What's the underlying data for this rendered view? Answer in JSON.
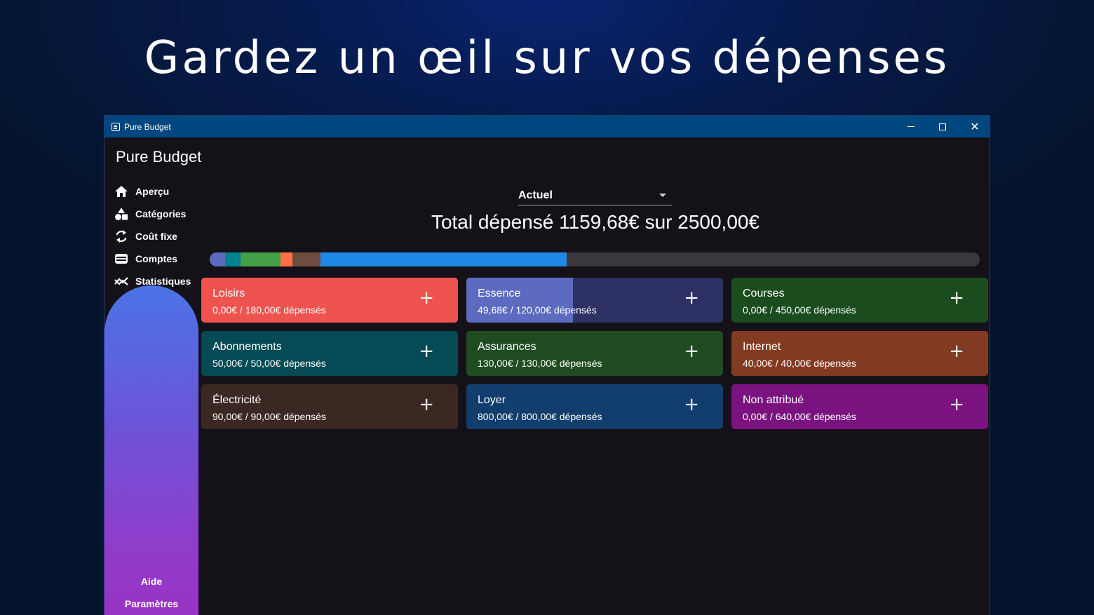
{
  "headline": "Gardez un œil sur vos dépenses",
  "window": {
    "title": "Pure Budget",
    "app_title": "Pure Budget"
  },
  "sidebar": {
    "items": [
      {
        "label": "Aperçu",
        "icon": "home-icon"
      },
      {
        "label": "Catégories",
        "icon": "shapes-icon"
      },
      {
        "label": "Coût fixe",
        "icon": "refresh-icon"
      },
      {
        "label": "Comptes",
        "icon": "wallet-icon"
      },
      {
        "label": "Statistiques",
        "icon": "chart-icon"
      }
    ],
    "help": "Aide",
    "settings": "Paramètres"
  },
  "period": {
    "selected": "Actuel"
  },
  "total": "Total dépensé 1159,68€ sur 2500,00€",
  "progress": {
    "total_spent": 1159.68,
    "budget": 2500.0,
    "segments": [
      {
        "name": "Essence",
        "value": 49.68,
        "color": "#5c6bc0"
      },
      {
        "name": "Abonnements",
        "value": 50.0,
        "color": "#00838f"
      },
      {
        "name": "Assurances",
        "value": 130.0,
        "color": "#43a047"
      },
      {
        "name": "Internet",
        "value": 40.0,
        "color": "#ff7043"
      },
      {
        "name": "Électricité",
        "value": 90.0,
        "color": "#6d4c41"
      },
      {
        "name": "Loyer",
        "value": 800.0,
        "color": "#1e88e5"
      }
    ],
    "track_color": "#3a383e"
  },
  "categories": [
    {
      "name": "Loisirs",
      "amount": "0,00€ / 180,00€ dépensés",
      "spent_fraction": 0.0,
      "color": "#ef5350",
      "fill_color": "#ef5350"
    },
    {
      "name": "Essence",
      "amount": "49,68€ / 120,00€ dépensés",
      "spent_fraction": 0.414,
      "color": "#2d3163",
      "fill_color": "#5c6bc0"
    },
    {
      "name": "Courses",
      "amount": "0,00€ / 450,00€ dépensés",
      "spent_fraction": 0.0,
      "color": "#1b4c1e",
      "fill_color": "#1b4c1e"
    },
    {
      "name": "Abonnements",
      "amount": "50,00€ / 50,00€ dépensés",
      "spent_fraction": 1.0,
      "color": "#054a54",
      "fill_color": "#054a54"
    },
    {
      "name": "Assurances",
      "amount": "130,00€ / 130,00€ dépensés",
      "spent_fraction": 1.0,
      "color": "#1f4d21",
      "fill_color": "#1f4d21"
    },
    {
      "name": "Internet",
      "amount": "40,00€ / 40,00€ dépensés",
      "spent_fraction": 1.0,
      "color": "#833a23",
      "fill_color": "#833a23"
    },
    {
      "name": "Électricité",
      "amount": "90,00€ / 90,00€ dépensés",
      "spent_fraction": 1.0,
      "color": "#3b2822",
      "fill_color": "#3b2822"
    },
    {
      "name": "Loyer",
      "amount": "800,00€ / 800,00€ dépensés",
      "spent_fraction": 1.0,
      "color": "#123e6d",
      "fill_color": "#123e6d"
    },
    {
      "name": "Non attribué",
      "amount": "0,00€ / 640,00€ dépensés",
      "spent_fraction": 0.0,
      "color": "#7a137f",
      "fill_color": "#7a137f"
    }
  ],
  "add_symbol": "+"
}
